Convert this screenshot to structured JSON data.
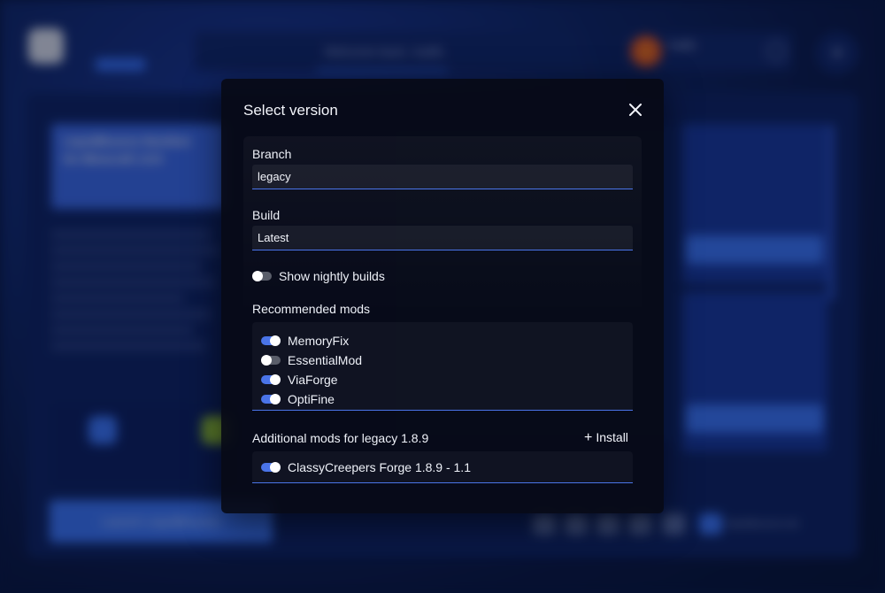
{
  "background": {
    "welcome_text": "Welcome back, Iradfo",
    "username": "Iradfo",
    "card_title": "LiquidBounce NextGen for Minecraft 1.8.9",
    "launch_label": "Launch LiquidBounce",
    "site_label": "liquidbounce.net"
  },
  "modal": {
    "title": "Select version",
    "branch": {
      "label": "Branch",
      "value": "legacy"
    },
    "build": {
      "label": "Build",
      "value": "Latest"
    },
    "nightly": {
      "label": "Show nightly builds",
      "enabled": false
    },
    "recommended": {
      "title": "Recommended mods",
      "mods": [
        {
          "name": "MemoryFix",
          "enabled": true
        },
        {
          "name": "EssentialMod",
          "enabled": false
        },
        {
          "name": "ViaForge",
          "enabled": true
        },
        {
          "name": "OptiFine",
          "enabled": true
        }
      ]
    },
    "additional": {
      "title": "Additional mods for legacy 1.8.9",
      "install_label": "Install",
      "mods": [
        {
          "name": "ClassyCreepers Forge 1.8.9 - 1.1",
          "enabled": true
        }
      ]
    }
  },
  "colors": {
    "accent": "#4a74e8",
    "modal_bg": "#080a16",
    "toggle_off": "#5a5e6a"
  }
}
